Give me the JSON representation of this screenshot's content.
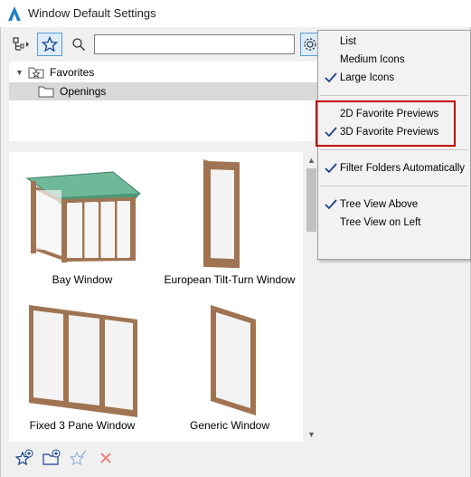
{
  "window": {
    "title": "Window Default Settings"
  },
  "toolbar": {
    "search": {
      "value": "",
      "placeholder": ""
    },
    "icons": [
      "browse-library-icon",
      "star-icon",
      "search-icon",
      "gear-icon"
    ]
  },
  "tree": {
    "items": [
      {
        "label": "Favorites",
        "icon": "favorites-folder-icon",
        "expanded": true
      },
      {
        "label": "Openings",
        "icon": "folder-icon",
        "selected": true
      }
    ]
  },
  "gallery": {
    "items": [
      {
        "label": "Bay Window"
      },
      {
        "label": "European Tilt-Turn Window"
      },
      {
        "label": "Fixed 3 Pane Window"
      },
      {
        "label": "Generic Window"
      }
    ]
  },
  "bottom_toolbar": {
    "icons": [
      "add-favorite-icon",
      "new-folder-icon",
      "edit-favorite-icon",
      "delete-icon"
    ]
  },
  "menu": {
    "items": [
      {
        "label": "List",
        "checked": false
      },
      {
        "label": "Medium Icons",
        "checked": false
      },
      {
        "label": "Large Icons",
        "checked": true
      },
      {
        "label": "2D Favorite Previews",
        "checked": false
      },
      {
        "label": "3D Favorite Previews",
        "checked": true
      },
      {
        "label": "Filter Folders Automatically",
        "checked": true
      },
      {
        "label": "Tree View Above",
        "checked": true
      },
      {
        "label": "Tree View on Left",
        "checked": false
      }
    ],
    "highlight_color": "#c00000"
  },
  "colors": {
    "accent": "#5a9bd5",
    "selected_row": "#d9d9d9",
    "frame_wood": "#9c7050",
    "roof_green": "#5fa88a"
  }
}
